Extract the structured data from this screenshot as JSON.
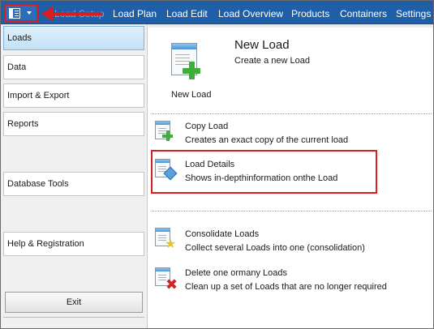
{
  "menubar": {
    "items": [
      {
        "label": "Load Setup"
      },
      {
        "label": "Load Plan"
      },
      {
        "label": "Load Edit"
      },
      {
        "label": "Load Overview"
      },
      {
        "label": "Products"
      },
      {
        "label": "Containers"
      },
      {
        "label": "Settings"
      }
    ]
  },
  "sidebar": {
    "items": [
      {
        "label": "Loads"
      },
      {
        "label": "Data"
      },
      {
        "label": "Import & Export"
      },
      {
        "label": "Reports"
      },
      {
        "label": "Database Tools"
      },
      {
        "label": "Help & Registration"
      }
    ],
    "exit_label": "Exit"
  },
  "content": {
    "new_load": {
      "title": "New Load",
      "description": "Create a new Load",
      "button_label": "New Load"
    },
    "actions": [
      {
        "title": "Copy Load",
        "description": "Creates an exact copy of the current load"
      },
      {
        "title": "Load Details",
        "description": "Shows in-depthinformation onthe Load"
      },
      {
        "title": "Consolidate Loads",
        "description": "Collect several Loads into one (consolidation)"
      },
      {
        "title": "Delete one ormany Loads",
        "description": "Clean up a set of Loads that are no longer required"
      }
    ]
  },
  "colors": {
    "menubar": "#1f5fa8",
    "highlight": "#d81e1e",
    "accent_green": "#3fae38"
  }
}
